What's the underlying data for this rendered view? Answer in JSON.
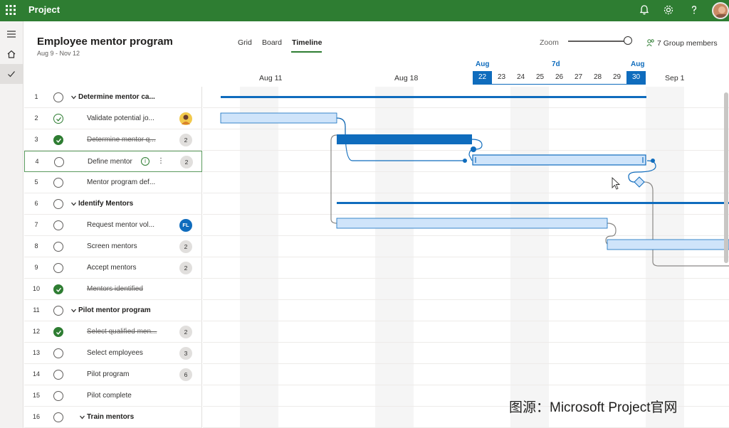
{
  "app": {
    "title": "Project"
  },
  "project": {
    "title": "Employee mentor program",
    "dates": "Aug 9 - Nov 12"
  },
  "tabs": [
    {
      "label": "Grid",
      "active": false
    },
    {
      "label": "Board",
      "active": false
    },
    {
      "label": "Timeline",
      "active": true
    }
  ],
  "zoom": {
    "label": "Zoom"
  },
  "members": {
    "label": "7 Group members"
  },
  "timeline": {
    "months": [
      "Aug 11",
      "Aug 18",
      "Sep 1"
    ],
    "selection": {
      "start_month": "Aug",
      "range": "7d",
      "end_month": "Aug"
    },
    "days": [
      "22",
      "23",
      "24",
      "25",
      "26",
      "27",
      "28",
      "29",
      "30"
    ]
  },
  "tasks": [
    {
      "num": "1",
      "name": "Determine mentor ca...",
      "kind": "group",
      "status": "open",
      "badge": ""
    },
    {
      "num": "2",
      "name": "Validate potential jo...",
      "kind": "task",
      "status": "partial",
      "badge": "person"
    },
    {
      "num": "3",
      "name": "Determine mentor q...",
      "kind": "task",
      "status": "done",
      "badge": "2"
    },
    {
      "num": "4",
      "name": "Define mentor",
      "kind": "task",
      "status": "open",
      "badge": "2",
      "selected": true
    },
    {
      "num": "5",
      "name": "Mentor program def...",
      "kind": "task",
      "status": "open",
      "badge": ""
    },
    {
      "num": "6",
      "name": "Identify Mentors",
      "kind": "group",
      "status": "open",
      "badge": ""
    },
    {
      "num": "7",
      "name": "Request mentor vol...",
      "kind": "task",
      "status": "open",
      "badge": "FL"
    },
    {
      "num": "8",
      "name": "Screen mentors",
      "kind": "task",
      "status": "open",
      "badge": "2"
    },
    {
      "num": "9",
      "name": "Accept mentors",
      "kind": "task",
      "status": "open",
      "badge": "2"
    },
    {
      "num": "10",
      "name": "Mentors identified",
      "kind": "task",
      "status": "done",
      "badge": ""
    },
    {
      "num": "11",
      "name": "Pilot mentor program",
      "kind": "group",
      "status": "open",
      "badge": ""
    },
    {
      "num": "12",
      "name": "Select qualified men...",
      "kind": "task",
      "status": "done",
      "badge": "2"
    },
    {
      "num": "13",
      "name": "Select employees",
      "kind": "task",
      "status": "open",
      "badge": "3"
    },
    {
      "num": "14",
      "name": "Pilot program",
      "kind": "task",
      "status": "open",
      "badge": "6"
    },
    {
      "num": "15",
      "name": "Pilot complete",
      "kind": "task",
      "status": "open",
      "badge": ""
    },
    {
      "num": "16",
      "name": "Train mentors",
      "kind": "subgroup",
      "status": "open",
      "badge": ""
    }
  ],
  "watermark": "图源：Microsoft Project官网",
  "colors": {
    "brand": "#2e7d32",
    "accent": "#0f6cbd",
    "bar_light": "#cfe4fa",
    "bar_dark": "#0f6cbd"
  }
}
